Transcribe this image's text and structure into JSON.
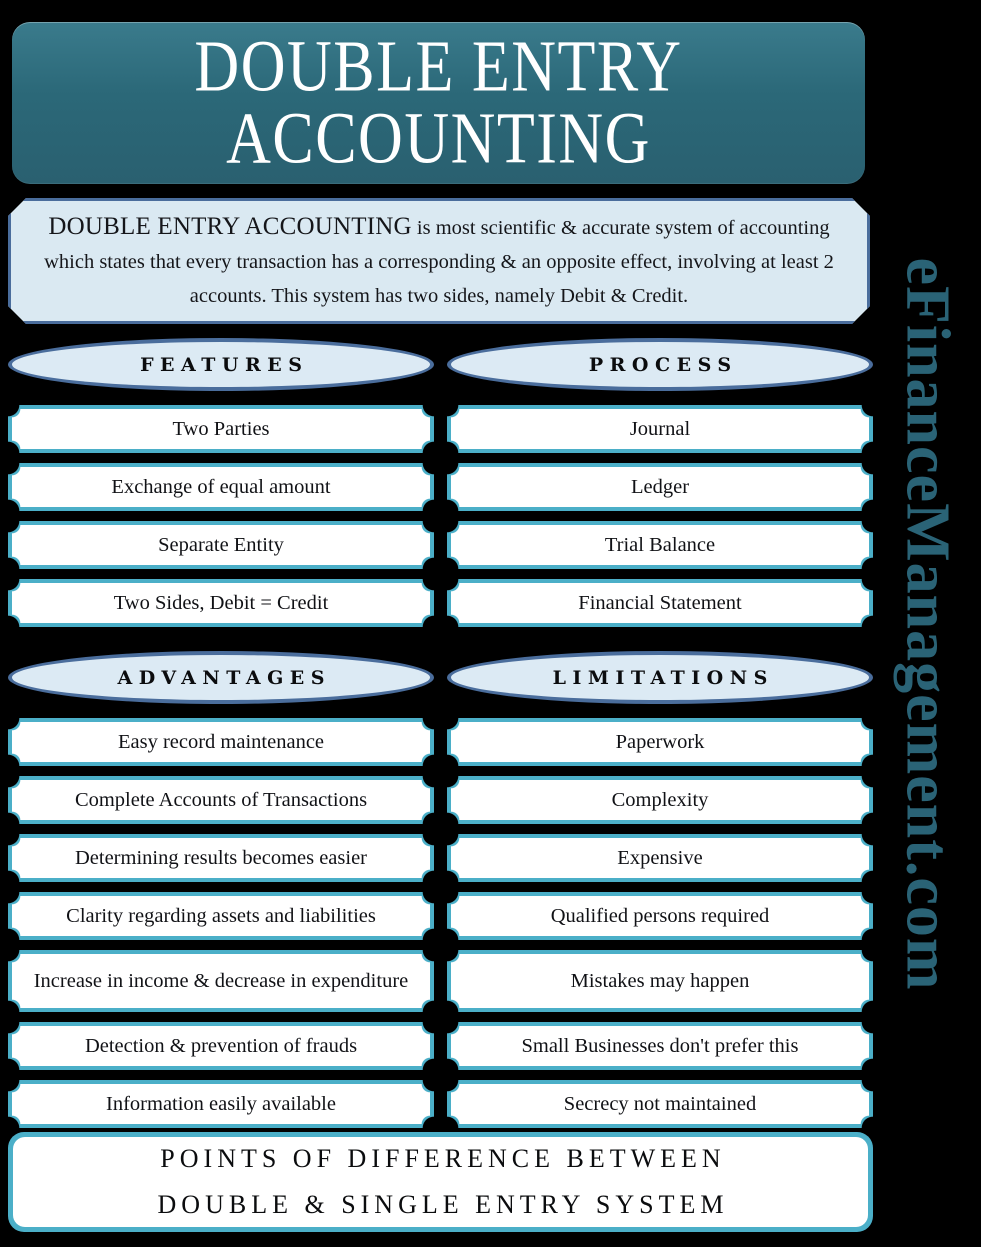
{
  "title": {
    "line1": "DOUBLE ENTRY",
    "line2": "ACCOUNTING"
  },
  "description": {
    "lead": "DOUBLE ENTRY ACCOUNTING",
    "body": " is most scientific & accurate system of accounting which states that every transaction has a corresponding & an opposite effect, involving at least 2 accounts. This system has two sides, namely Debit & Credit."
  },
  "sections": {
    "features": {
      "heading": "FEATURES",
      "items": [
        "Two Parties",
        "Exchange of equal amount",
        "Separate Entity",
        "Two Sides, Debit = Credit"
      ]
    },
    "process": {
      "heading": "PROCESS",
      "items": [
        "Journal",
        "Ledger",
        "Trial Balance",
        "Financial Statement"
      ]
    },
    "advantages": {
      "heading": "ADVANTAGES",
      "items": [
        "Easy record maintenance",
        "Complete Accounts of Transactions",
        "Determining results becomes easier",
        "Clarity regarding assets and liabilities",
        "Increase in income & decrease in expenditure",
        "Detection & prevention of frauds",
        "Information easily available"
      ]
    },
    "limitations": {
      "heading": "LIMITATIONS",
      "items": [
        "Paperwork",
        "Complexity",
        "Expensive",
        "Qualified persons required",
        "Mistakes may happen",
        "Small Businesses don't prefer this",
        "Secrecy not maintained"
      ]
    }
  },
  "footer": {
    "line1": "POINTS OF DIFFERENCE BETWEEN",
    "line2": "DOUBLE & SINGLE ENTRY SYSTEM"
  },
  "brand": {
    "text": "eFinanceManagement.com"
  },
  "colors": {
    "background": "#000000",
    "banner_teal": "#2b6878",
    "card_border_teal": "#4bafc8",
    "oval_border_blue": "#4a6d9c",
    "oval_fill": "#dceaf4",
    "desc_fill": "#dae9f2",
    "brand_teal": "#2a6376",
    "card_fill": "#ffffff",
    "text_dark": "#111216",
    "text_light": "#ffffff"
  }
}
